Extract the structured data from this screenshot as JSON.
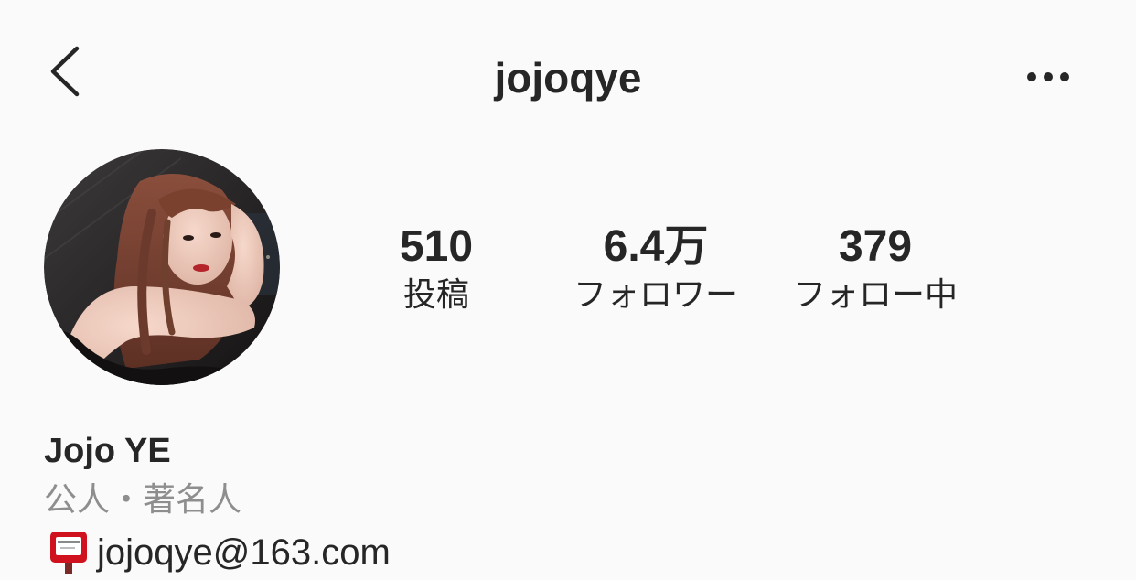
{
  "header": {
    "username": "jojoqye",
    "back_icon": "chevron-left-icon",
    "more_icon": "ellipsis-horizontal-icon"
  },
  "profile": {
    "avatar_alt": "profile photo",
    "stats": [
      {
        "value": "510",
        "label": "投稿"
      },
      {
        "value": "6.4万",
        "label": "フォロワー"
      },
      {
        "value": "379",
        "label": "フォロー中"
      }
    ],
    "display_name": "Jojo YE",
    "category": "公人・著名人",
    "email_icon": "mailbox-icon",
    "email": "jojoqye@163.com"
  },
  "colors": {
    "background": "#fafafa",
    "text_primary": "#262626",
    "text_secondary": "#8e8e8e",
    "mailbox_red": "#c8102e"
  }
}
